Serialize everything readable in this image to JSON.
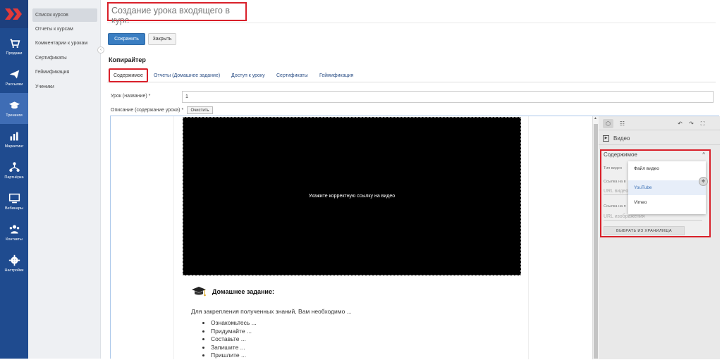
{
  "navbar": {
    "items": [
      {
        "label": "Продажи",
        "icon": "cart-icon"
      },
      {
        "label": "Рассылки",
        "icon": "paper-plane-icon"
      },
      {
        "label": "Тренинги",
        "icon": "graduation-cap-icon"
      },
      {
        "label": "Маркетинг",
        "icon": "bar-chart-icon"
      },
      {
        "label": "Партнёрка",
        "icon": "partner-network-icon"
      },
      {
        "label": "Вебинары",
        "icon": "webinar-icon"
      },
      {
        "label": "Контакты",
        "icon": "contacts-icon"
      },
      {
        "label": "Настройки",
        "icon": "gear-icon"
      }
    ],
    "active": "Тренинги"
  },
  "submenu": {
    "items": [
      {
        "label": "Список курсов"
      },
      {
        "label": "Отчеты к курсам"
      },
      {
        "label": "Комментарии к урокам"
      },
      {
        "label": "Сертификаты"
      },
      {
        "label": "Геймификация"
      },
      {
        "label": "Ученики"
      }
    ]
  },
  "page": {
    "title": "Создание урока входящего в курс",
    "save_label": "Сохранить",
    "close_label": "Закрыть",
    "course_name": "Копирайтер"
  },
  "tabs": [
    {
      "label": "Содержимое",
      "active": true
    },
    {
      "label": "Отчеты (Домашнее задание)"
    },
    {
      "label": "Доступ к уроку"
    },
    {
      "label": "Сертификаты"
    },
    {
      "label": "Геймификация"
    }
  ],
  "form": {
    "name_label": "Урок (название) *",
    "name_value": "1",
    "desc_label": "Описание (содержание урока) *",
    "clear_label": "Очистить"
  },
  "editor": {
    "video_message": "Укажите корректную ссылку на видео",
    "hw_title": "Домашнее задание:",
    "hw_text": "Для закрепления полученных знаний, Вам необходимо ...",
    "hw_items": [
      "Ознакомьтесь ...",
      "Придумайте ...",
      "Составьте ...",
      "Запишите ...",
      "Пришлите ..."
    ]
  },
  "panel": {
    "video_label": "Видео",
    "section_label": "Содержимое",
    "type_label": "Тип видео",
    "link_label": "Ссылка на в",
    "url_placeholder": "URL видео",
    "link2_label": "Ссылка на п",
    "img_placeholder": "URL изображения",
    "storage_label": "ВЫБРАТЬ ИЗ ХРАНИЛИЩА",
    "dropdown": [
      {
        "label": "Файл видео"
      },
      {
        "label": "YouTube",
        "selected": true
      },
      {
        "label": "Vimeo"
      }
    ]
  },
  "colors": {
    "nav_bg": "#1f4b8f",
    "nav_active": "#3f6db5",
    "accent": "#3a7ec2",
    "highlight": "#d9202a"
  }
}
